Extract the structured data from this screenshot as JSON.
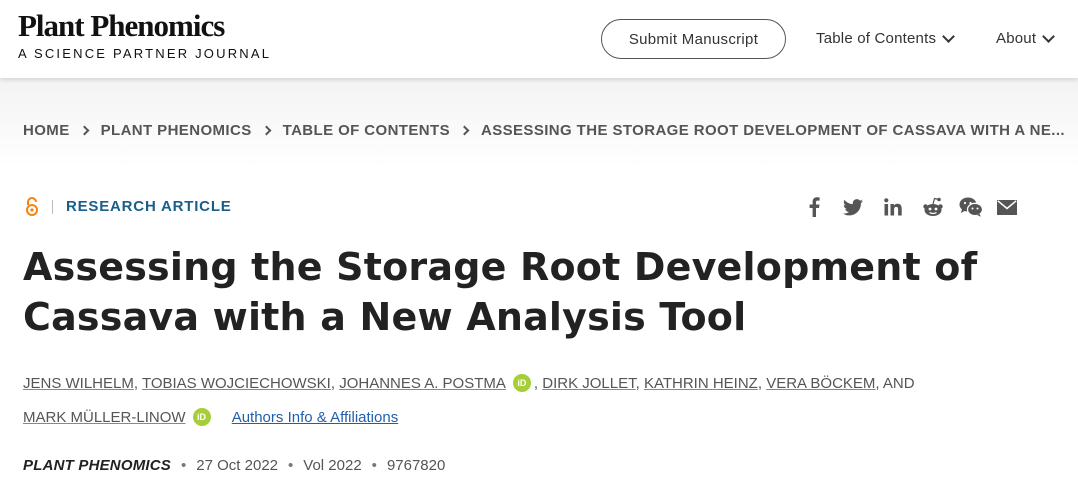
{
  "header": {
    "brand_name": "Plant Phenomics",
    "brand_tagline": "A SCIENCE PARTNER JOURNAL",
    "submit_label": "Submit Manuscript",
    "nav": [
      {
        "label": "Table of Contents",
        "icon": "chevron-down-icon"
      },
      {
        "label": "About",
        "icon": "chevron-down-icon"
      }
    ]
  },
  "breadcrumb": [
    "HOME",
    "PLANT PHENOMICS",
    "TABLE OF CONTENTS",
    "ASSESSING THE STORAGE ROOT DEVELOPMENT OF CASSAVA WITH A NE..."
  ],
  "article": {
    "access_icon": "open-access-icon",
    "type": "RESEARCH ARTICLE",
    "title_line1": "Assessing the Storage Root Development of",
    "title_line2": "Cassava with a New Analysis Tool",
    "authors": [
      "JENS WILHELM",
      "TOBIAS WOJCIECHOWSKI",
      "JOHANNES A. POSTMA",
      "DIRK JOLLET",
      "KATHRIN HEINZ",
      "VERA BÖCKEM",
      "MARK MÜLLER-LINOW"
    ],
    "and_text": "AND",
    "orcid_text": "iD",
    "affiliations_link": "Authors Info & Affiliations",
    "journal": "PLANT PHENOMICS",
    "date": "27 Oct 2022",
    "volume": "Vol 2022",
    "article_number": "9767820",
    "dot": "•"
  },
  "share_icons": [
    "facebook-icon",
    "twitter-icon",
    "linkedin-icon",
    "reddit-icon",
    "wechat-icon",
    "email-icon"
  ],
  "colors": {
    "accent_blue": "#1a5e8a",
    "link_blue": "#1f5fae",
    "orcid_green": "#a6ce39",
    "open_access_orange": "#f68212"
  }
}
